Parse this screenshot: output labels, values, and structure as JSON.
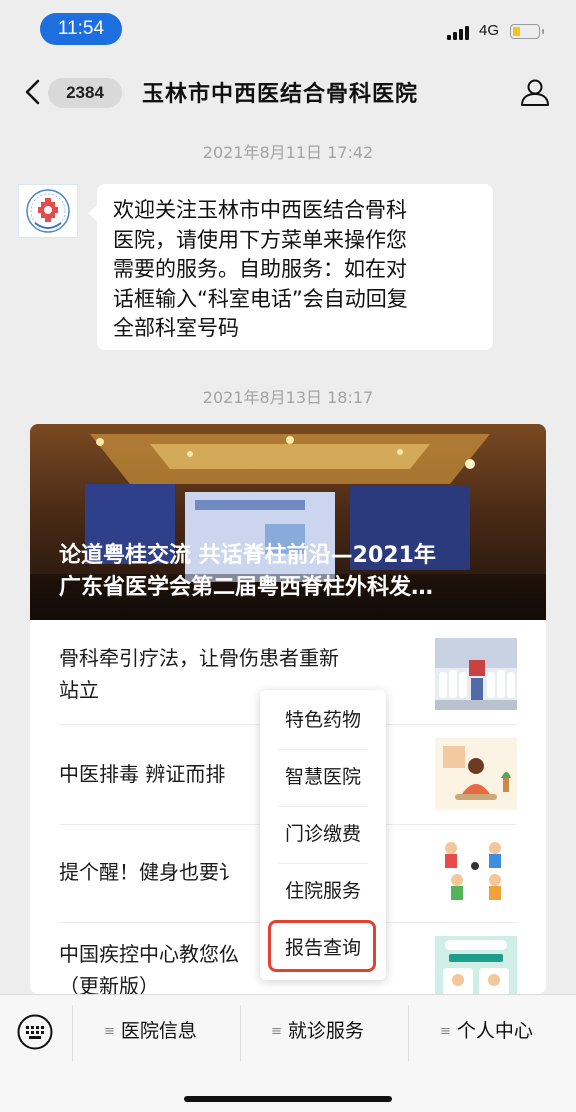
{
  "status_bar": {
    "time": "11:54",
    "network": "4G",
    "battery_level": 0.3
  },
  "nav": {
    "unread_count": "2384",
    "title": "玉林市中西医结合骨科医院"
  },
  "messages": [
    {
      "timestamp": "2021年8月11日 17:42",
      "lines": [
        "欢迎关注玉林市中西医结合骨科",
        "医院，请使用下方菜单来操作您",
        "需要的服务。自助服务：如在对",
        "话框输入“科室电话”会自动回复",
        "全部科室号码"
      ]
    },
    {
      "timestamp": "2021年8月13日 18:17"
    }
  ],
  "article_card": {
    "hero_title_lines": [
      "论道粤桂交流 共话脊柱前沿—2021年",
      "广东省医学会第二届粤西脊柱外科发…"
    ],
    "items": [
      {
        "title_lines": [
          "骨科牵引疗法，让骨伤患者重新",
          "站立"
        ]
      },
      {
        "title_lines": [
          "中医排毒 辨证而排"
        ]
      },
      {
        "title_lines": [
          "提个醒！健身也要讠"
        ]
      },
      {
        "title_lines": [
          "中国疾控中心教您仫",
          "（更新版）"
        ]
      }
    ]
  },
  "popup_menu": {
    "items": [
      "特色药物",
      "智慧医院",
      "门诊缴费",
      "住院服务",
      "报告查询"
    ],
    "highlighted_index": 4,
    "highlight_color": "#e0442f"
  },
  "bottom_menu": {
    "tabs": [
      "医院信息",
      "就诊服务",
      "个人中心"
    ]
  },
  "colors": {
    "time_pill": "#1d6fe0",
    "battery": "#f5c518",
    "background": "#ededed"
  },
  "icons": [
    "back-icon",
    "profile-icon",
    "keyboard-icon",
    "signal-icon",
    "battery-icon"
  ]
}
